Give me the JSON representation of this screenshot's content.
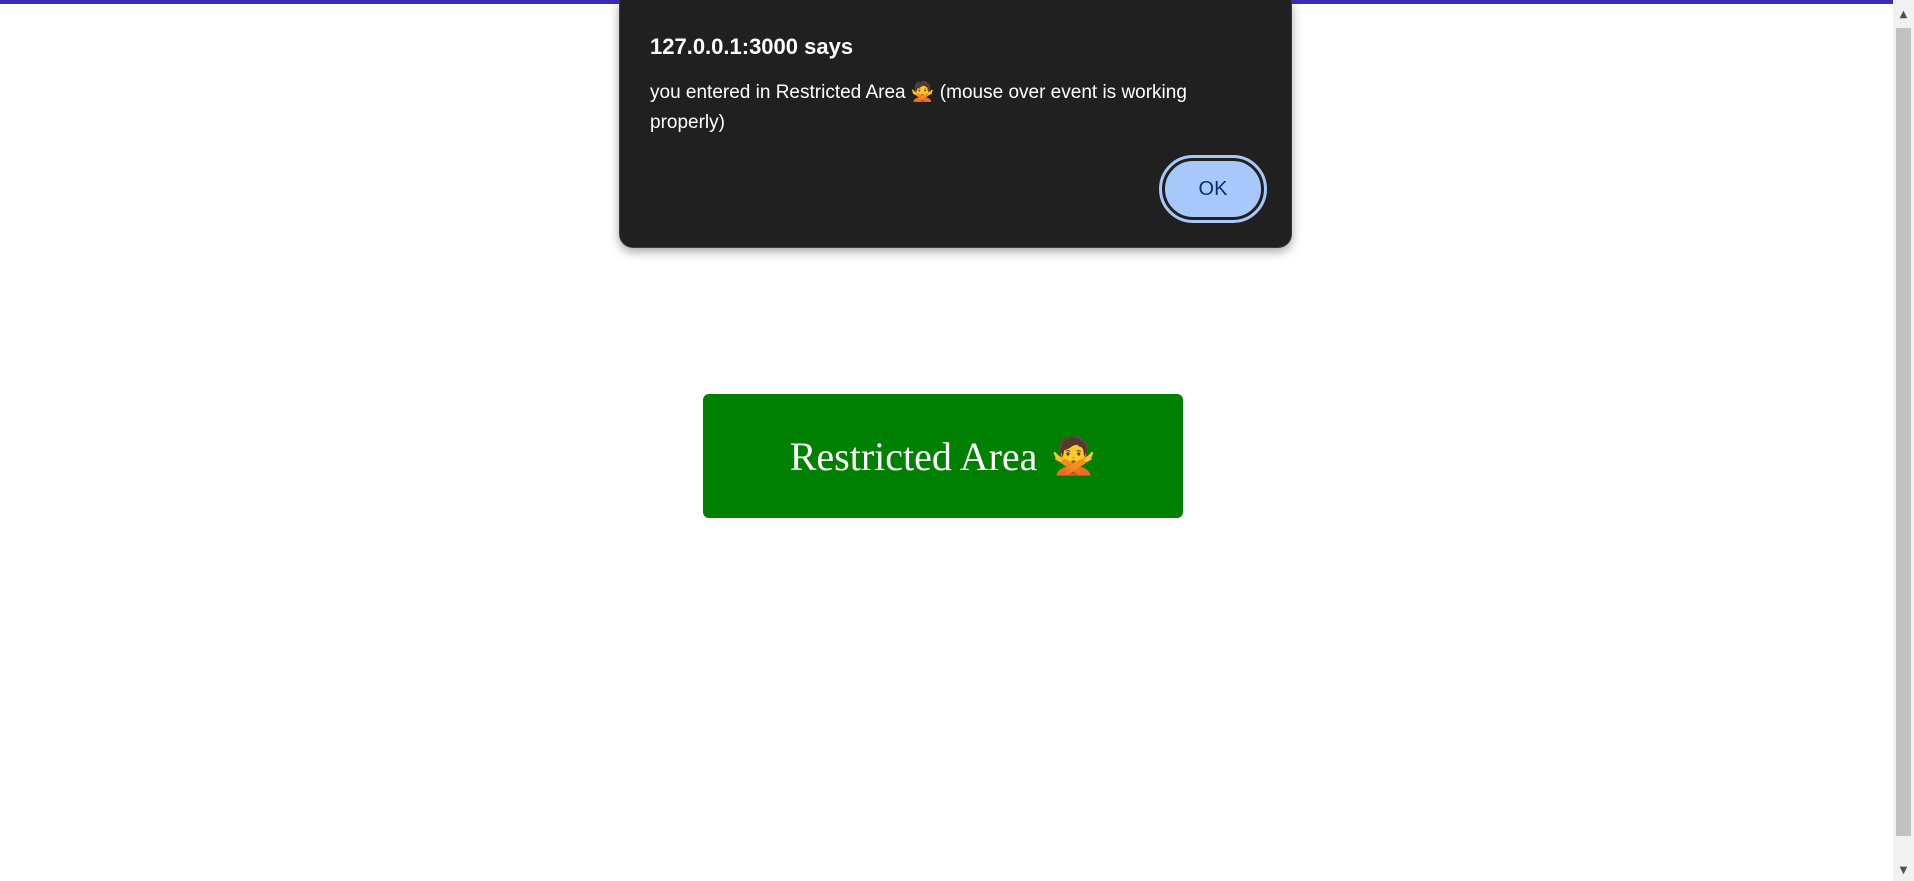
{
  "page": {
    "button_label": "Restricted Area",
    "button_emoji": "🙅",
    "button_color": "#008000",
    "accent_color": "#3b2db2"
  },
  "dialog": {
    "title": "127.0.0.1:3000 says",
    "message": "you entered in Restricted Area 🙅 (mouse over event is working properly)",
    "ok_label": "OK"
  },
  "scrollbar": {
    "up_icon": "scroll-up-arrow-icon",
    "down_icon": "scroll-down-arrow-icon"
  }
}
